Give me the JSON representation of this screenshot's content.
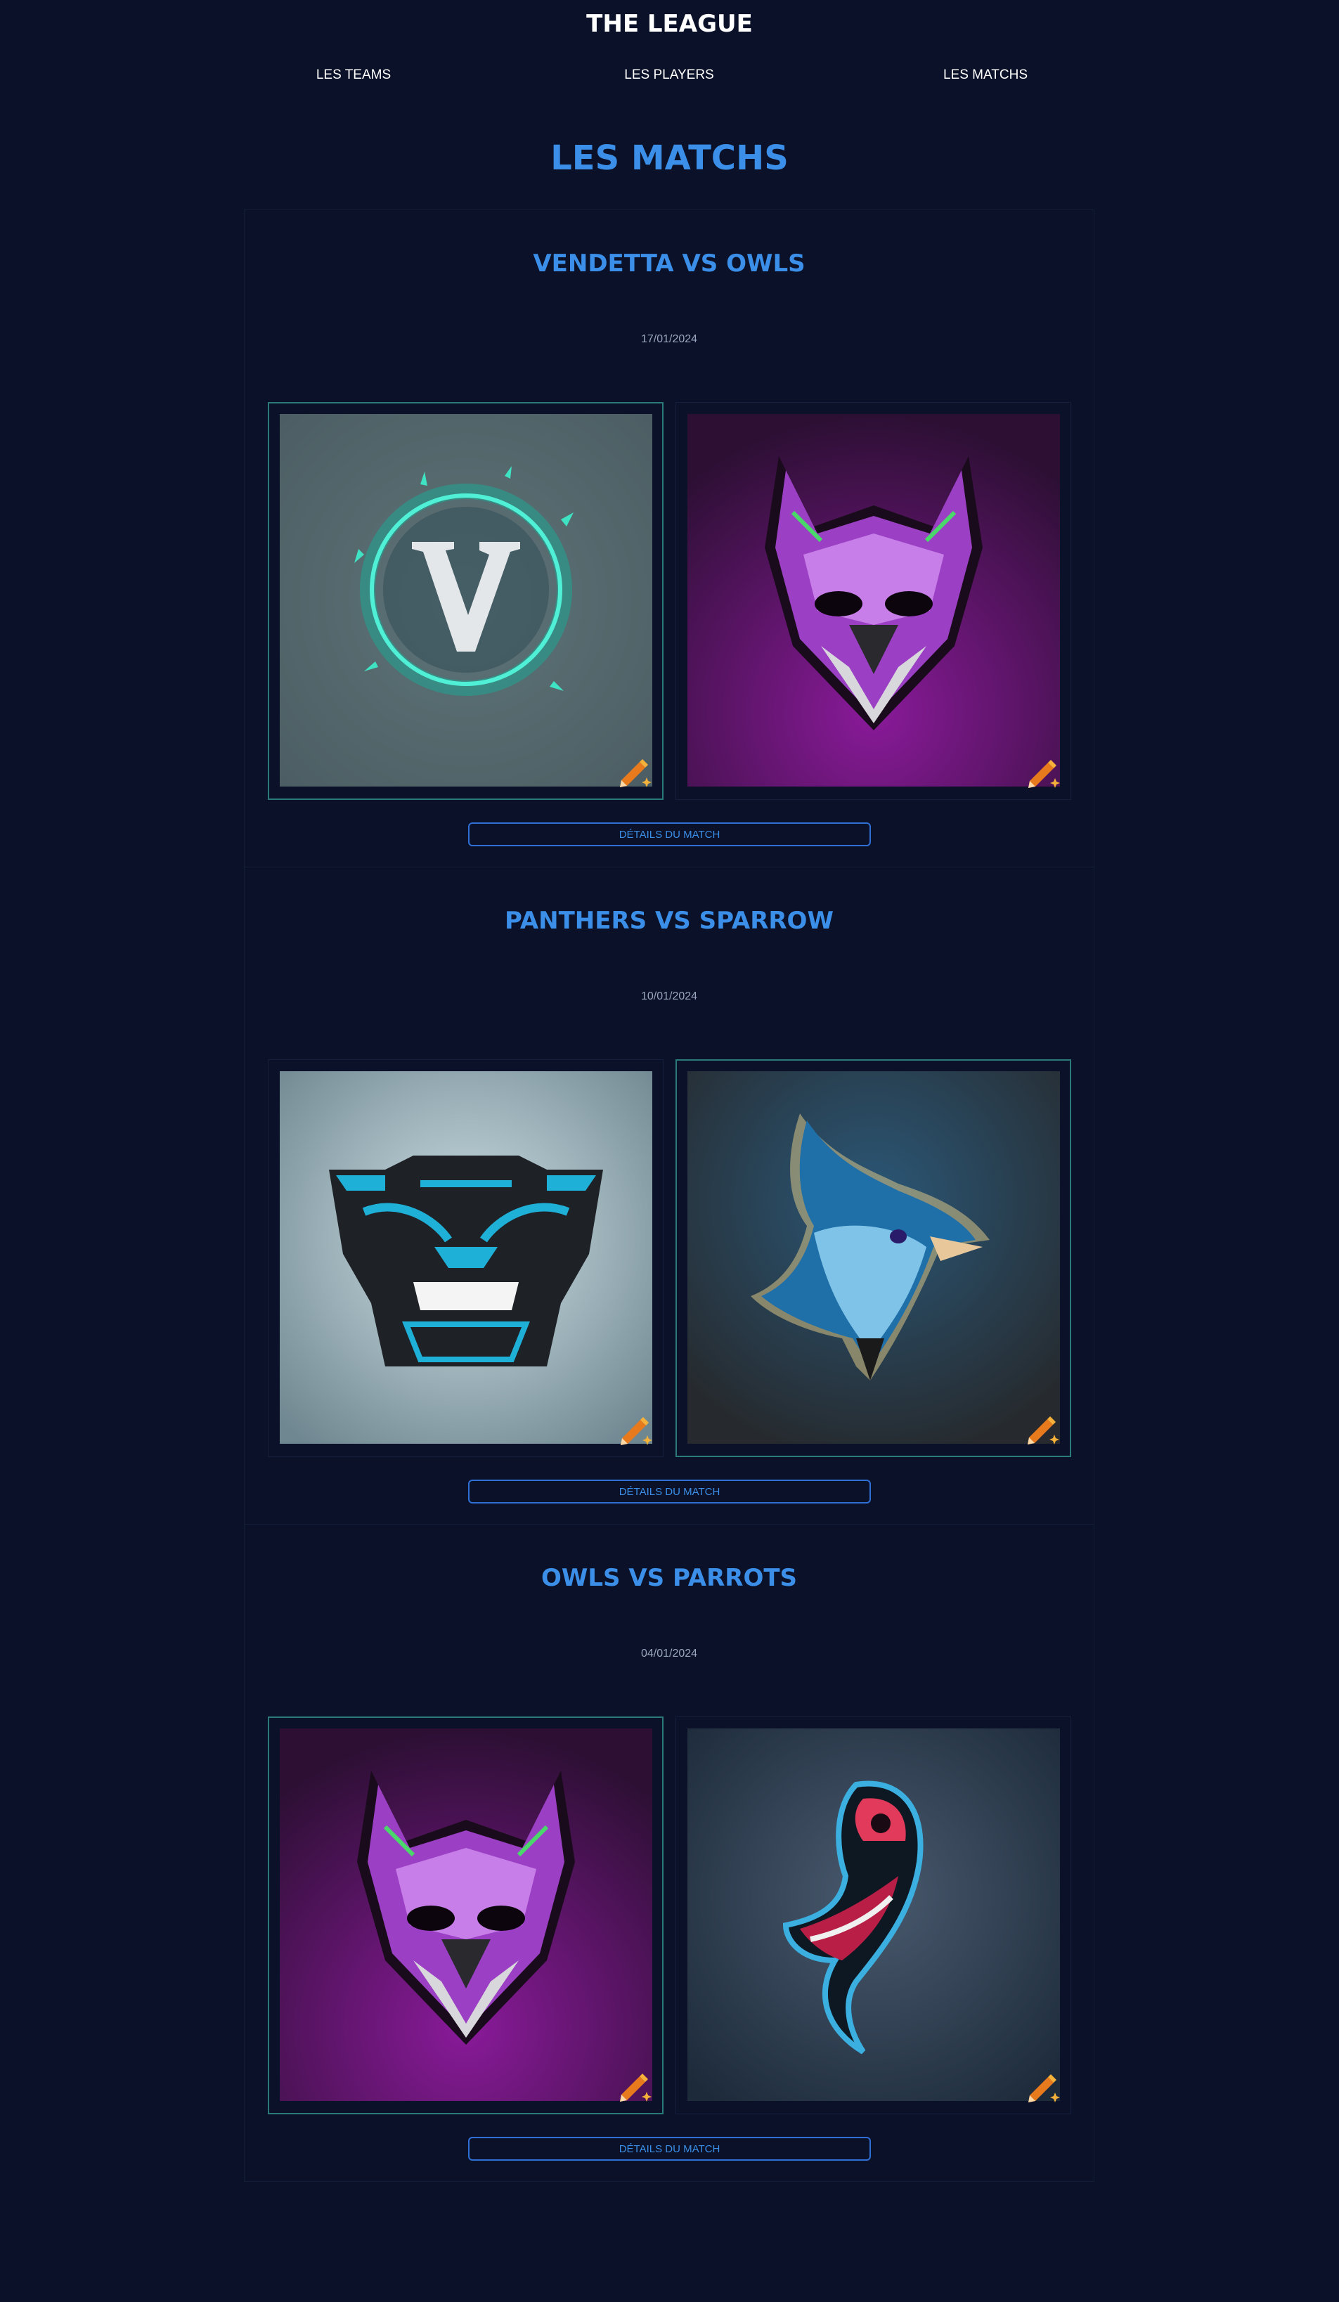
{
  "site": {
    "title": "THE LEAGUE"
  },
  "nav": {
    "items": [
      "LES TEAMS",
      "LES PLAYERS",
      "LES MATCHS"
    ]
  },
  "page": {
    "heading": "LES MATCHS"
  },
  "colors": {
    "background": "#0a1128",
    "accent": "#3b8fe8",
    "winner_border": "#2a7a7a",
    "edit_icon": "#e87a1e"
  },
  "matches": [
    {
      "title": "VENDETTA VS OWLS",
      "date": "17/01/2024",
      "home": {
        "team": "Vendetta",
        "logo_icon": "vendetta-v-logo",
        "winner": true
      },
      "away": {
        "team": "Owls",
        "logo_icon": "purple-owl-logo",
        "winner": false
      },
      "button_label": "DÉTAILS DU MATCH"
    },
    {
      "title": "PANTHERS VS SPARROW",
      "date": "10/01/2024",
      "home": {
        "team": "Panthers",
        "logo_icon": "black-panther-logo",
        "winner": false
      },
      "away": {
        "team": "Sparrow",
        "logo_icon": "blue-bird-logo",
        "winner": true
      },
      "button_label": "DÉTAILS DU MATCH"
    },
    {
      "title": "OWLS VS PARROTS",
      "date": "04/01/2024",
      "home": {
        "team": "Owls",
        "logo_icon": "purple-owl-logo",
        "winner": true
      },
      "away": {
        "team": "Parrots",
        "logo_icon": "red-parrot-logo",
        "winner": false
      },
      "button_label": "DÉTAILS DU MATCH"
    }
  ]
}
